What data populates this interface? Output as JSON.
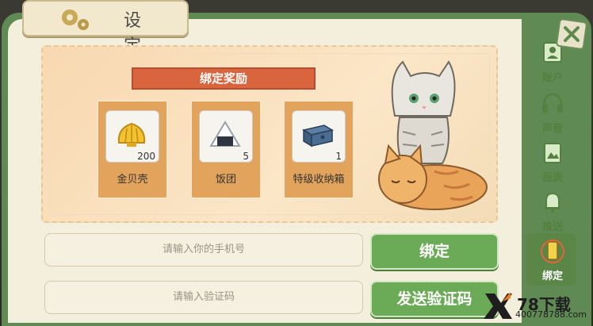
{
  "header": {
    "title": "设 定",
    "settings_icon": "gear-icon"
  },
  "reward": {
    "banner": "绑定奖励",
    "items": [
      {
        "label": "金贝壳",
        "count": "200",
        "icon": "golden-shell-icon"
      },
      {
        "label": "饭团",
        "count": "5",
        "icon": "rice-ball-icon"
      },
      {
        "label": "特级收纳箱",
        "count": "1",
        "icon": "storage-box-icon"
      }
    ]
  },
  "form": {
    "phone_placeholder": "请输入你的手机号",
    "code_placeholder": "请输入验证码",
    "bind_button": "绑定",
    "send_code_button": "发送验证码"
  },
  "sidebar": {
    "items": [
      {
        "label": "账户",
        "icon": "account-icon"
      },
      {
        "label": "声音",
        "icon": "headphones-icon"
      },
      {
        "label": "画质",
        "icon": "image-quality-icon"
      },
      {
        "label": "推送",
        "icon": "bell-icon"
      },
      {
        "label": "绑定",
        "icon": "phone-icon",
        "active": true
      }
    ]
  },
  "watermark": {
    "main": "78下载",
    "sub": "400778788.com"
  },
  "colors": {
    "panel": "#f4eedc",
    "frame": "#5f8a54",
    "accent_button": "#6bab57",
    "banner": "#d9653f"
  }
}
